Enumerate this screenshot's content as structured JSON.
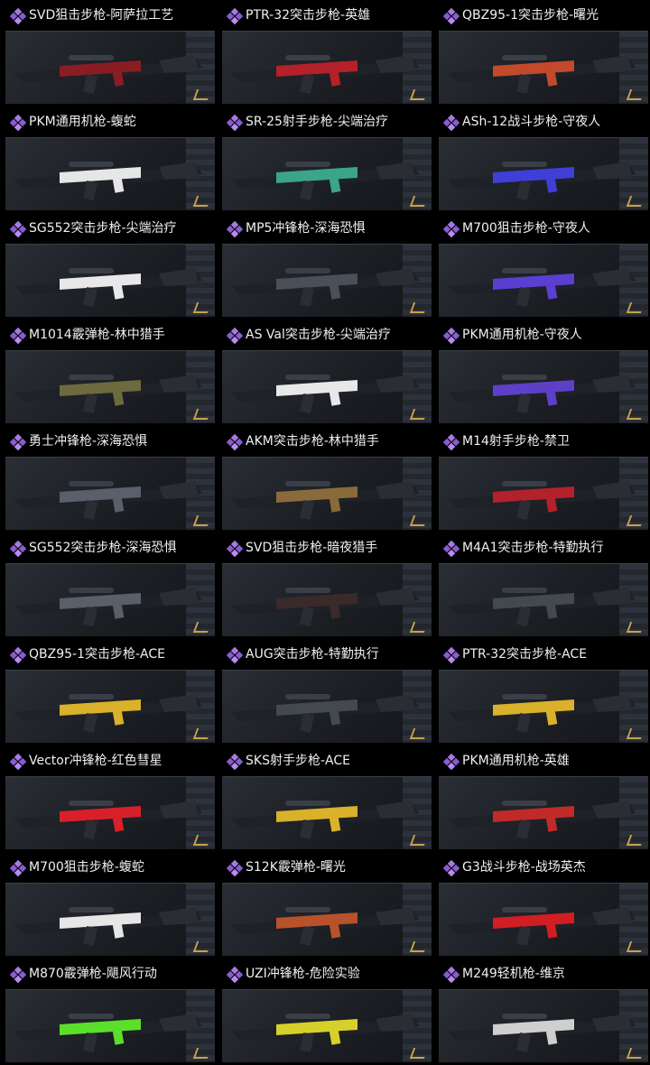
{
  "colors": {
    "background": "#000000",
    "title_text": "#f0f0f0",
    "rarity_diamond": "#a47be0",
    "panel": "#1f2228",
    "stand_accent": "#c9a24a"
  },
  "icon": "rarity-diamond-icon",
  "skins": [
    {
      "title": "SVD狙击步枪-阿萨拉工艺",
      "accent": "#8a1c24"
    },
    {
      "title": "PTR-32突击步枪-英雄",
      "accent": "#b3212a"
    },
    {
      "title": "QBZ95-1突击步枪-曙光",
      "accent": "#c24a2a"
    },
    {
      "title": "PKM通用机枪-蝮蛇",
      "accent": "#e6e6e6"
    },
    {
      "title": "SR-25射手步枪-尖端治疗",
      "accent": "#3aa58a"
    },
    {
      "title": "ASh-12战斗步枪-守夜人",
      "accent": "#3f3fd8"
    },
    {
      "title": "SG552突击步枪-尖端治疗",
      "accent": "#e8e8e8"
    },
    {
      "title": "MP5冲锋枪-深海恐惧",
      "accent": "#4a4f58"
    },
    {
      "title": "M700狙击步枪-守夜人",
      "accent": "#5a3fd0"
    },
    {
      "title": "M1014霰弹枪-林中猎手",
      "accent": "#6d6a3e"
    },
    {
      "title": "AS Val突击步枪-尖端治疗",
      "accent": "#e8e8e8"
    },
    {
      "title": "PKM通用机枪-守夜人",
      "accent": "#5e3fc8"
    },
    {
      "title": "勇士冲锋枪-深海恐惧",
      "accent": "#5a606a"
    },
    {
      "title": "AKM突击步枪-林中猎手",
      "accent": "#8a6a3a"
    },
    {
      "title": "M14射手步枪-禁卫",
      "accent": "#b3212a"
    },
    {
      "title": "SG552突击步枪-深海恐惧",
      "accent": "#5a606a"
    },
    {
      "title": "SVD狙击步枪-暗夜猎手",
      "accent": "#3a2a2a"
    },
    {
      "title": "M4A1突击步枪-特勤执行",
      "accent": "#44484f"
    },
    {
      "title": "QBZ95-1突击步枪-ACE",
      "accent": "#d9b12a"
    },
    {
      "title": "AUG突击步枪-特勤执行",
      "accent": "#44484f"
    },
    {
      "title": "PTR-32突击步枪-ACE",
      "accent": "#d9b12a"
    },
    {
      "title": "Vector冲锋枪-红色彗星",
      "accent": "#d8202a"
    },
    {
      "title": "SKS射手步枪-ACE",
      "accent": "#d9b12a"
    },
    {
      "title": "PKM通用机枪-英雄",
      "accent": "#c22a2a"
    },
    {
      "title": "M700狙击步枪-蝮蛇",
      "accent": "#e6e6e6"
    },
    {
      "title": "S12K霰弹枪-曙光",
      "accent": "#b8522a"
    },
    {
      "title": "G3战斗步枪-战场英杰",
      "accent": "#d01e22"
    },
    {
      "title": "M870霰弹枪-飓风行动",
      "accent": "#5ae02a"
    },
    {
      "title": "UZI冲锋枪-危险实验",
      "accent": "#d8d02a"
    },
    {
      "title": "M249轻机枪-维京",
      "accent": "#cfcfcf"
    }
  ]
}
